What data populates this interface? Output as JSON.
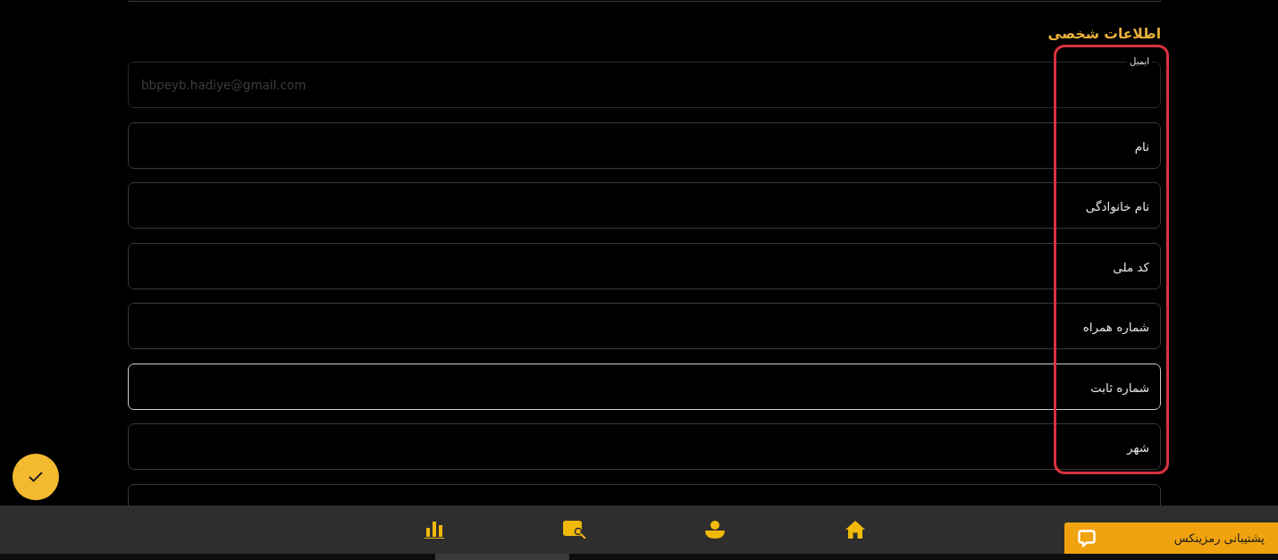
{
  "section": {
    "title": "اطلاعات شخصی"
  },
  "form": {
    "highlight": true,
    "fields": [
      {
        "label": "ایمیل",
        "value": "bbpeyb.hadiye@gmail.com",
        "disabled": true,
        "focused": false
      },
      {
        "placeholder": "نام",
        "disabled": false,
        "focused": false
      },
      {
        "placeholder": "نام خانوادگی",
        "disabled": false,
        "focused": false
      },
      {
        "placeholder": "کد ملی",
        "disabled": false,
        "focused": false
      },
      {
        "placeholder": "شماره همراه",
        "disabled": false,
        "focused": false
      },
      {
        "placeholder": "شماره ثابت",
        "disabled": false,
        "focused": true
      },
      {
        "placeholder": "شهر",
        "disabled": false,
        "focused": false
      }
    ]
  },
  "fields_below": [
    {
      "disabled": false,
      "focused": false
    }
  ],
  "nav": [
    {
      "kind": "home"
    },
    {
      "kind": "user"
    },
    {
      "kind": "wallet"
    },
    {
      "kind": "chart"
    }
  ],
  "support": {
    "label": "پشتیبانی رمزینکس"
  }
}
